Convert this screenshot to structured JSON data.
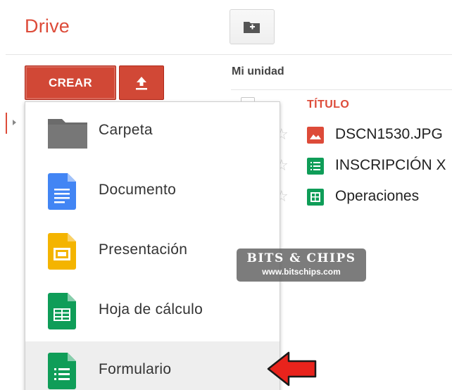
{
  "app": {
    "logo": "Drive"
  },
  "toolbar": {
    "crear_label": "CREAR",
    "upload_icon": "upload-arrow-icon",
    "new_folder_icon": "new-folder-icon"
  },
  "breadcrumb": {
    "current": "Mi unidad"
  },
  "file_list": {
    "column_title": "TÍTULO",
    "rows": [
      {
        "name": "DSCN1530.JPG",
        "icon": "image-file-icon",
        "icon_color": "#dd4b39"
      },
      {
        "name": "INSCRIPCIÓN X",
        "icon": "form-file-icon",
        "icon_color": "#0f9d58"
      },
      {
        "name": "Operaciones",
        "icon": "spreadsheet-file-icon",
        "icon_color": "#0f9d58"
      }
    ]
  },
  "create_menu": {
    "items": [
      {
        "label": "Carpeta",
        "icon": "folder-icon",
        "color": "#6b6b6b"
      },
      {
        "label": "Documento",
        "icon": "document-icon",
        "color": "#4285f4"
      },
      {
        "label": "Presentación",
        "icon": "presentation-icon",
        "color": "#f4b400"
      },
      {
        "label": "Hoja de cálculo",
        "icon": "spreadsheet-icon",
        "color": "#0f9d58"
      },
      {
        "label": "Formulario",
        "icon": "form-icon",
        "color": "#0f9d58",
        "highlighted": true
      }
    ]
  },
  "watermark": {
    "title": "BITS & CHIPS",
    "url": "www.bitschips.com"
  },
  "colors": {
    "brand_red": "#dd4b39",
    "button_red": "#d14836",
    "menu_hover": "#eeeeee"
  }
}
